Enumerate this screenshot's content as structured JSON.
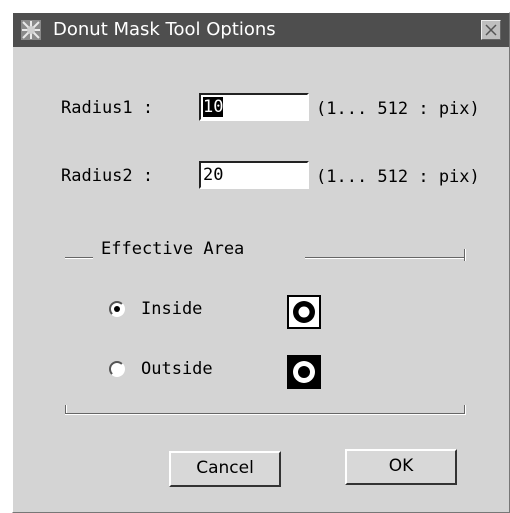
{
  "window": {
    "title": "Donut Mask Tool Options",
    "close_icon": "close-icon"
  },
  "radius1": {
    "label": "Radius1 :",
    "value": "10",
    "range": "(1... 512 : pix)"
  },
  "radius2": {
    "label": "Radius2 :",
    "value": "20",
    "range": "(1... 512 : pix)"
  },
  "effective_area": {
    "title": "Effective Area",
    "options": [
      {
        "label": "Inside",
        "selected": true,
        "icon": "donut-inside-icon"
      },
      {
        "label": "Outside",
        "selected": false,
        "icon": "donut-outside-icon"
      }
    ]
  },
  "buttons": {
    "cancel": "Cancel",
    "ok": "OK"
  }
}
